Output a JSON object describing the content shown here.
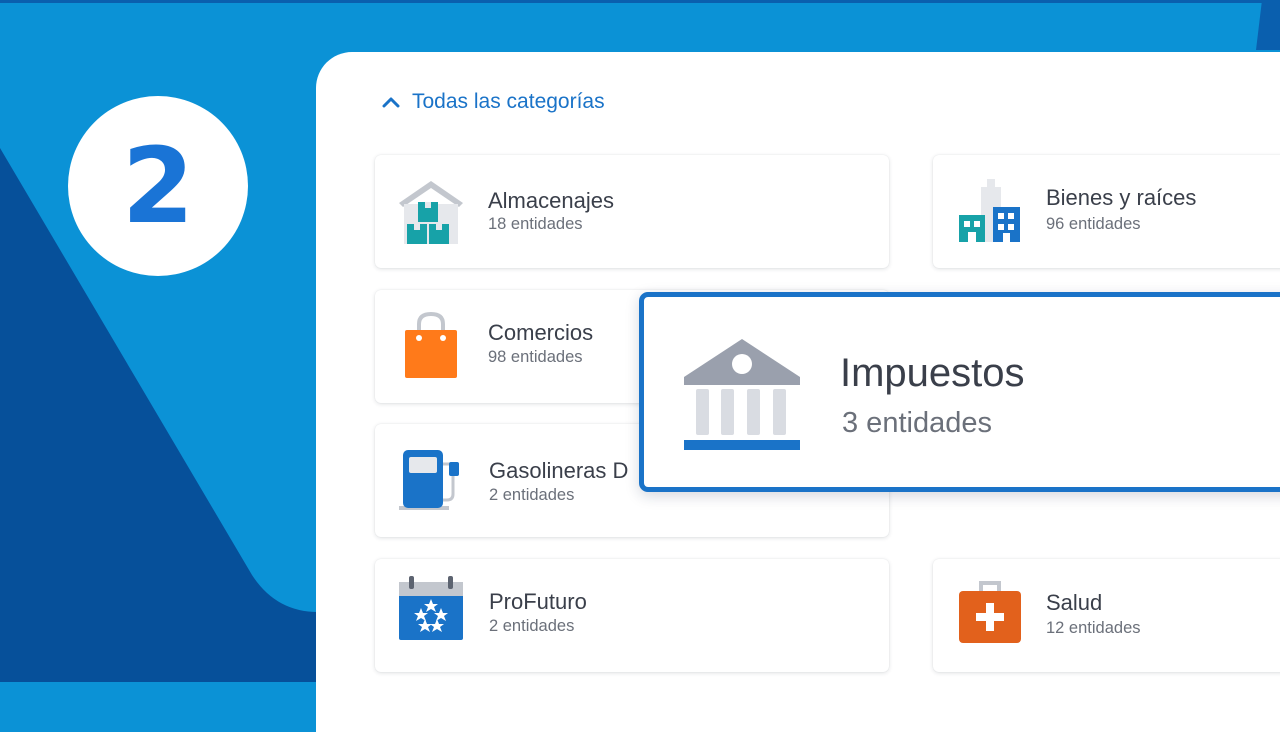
{
  "step": {
    "number": "2"
  },
  "header": {
    "all_categories_label": "Todas las categorías"
  },
  "categories": [
    {
      "title": "Almacenajes",
      "subtitle": "18 entidades",
      "icon": "warehouse-icon"
    },
    {
      "title": "Bienes y raíces",
      "subtitle": "96 entidades",
      "icon": "buildings-icon"
    },
    {
      "title": "Comercios",
      "subtitle": "98 entidades",
      "icon": "shopping-bag-icon"
    },
    {
      "title": "Gasolineras D",
      "subtitle": "2 entidades",
      "icon": "gas-pump-icon"
    },
    {
      "title": "ProFuturo",
      "subtitle": "2 entidades",
      "icon": "calendar-stars-icon"
    },
    {
      "title": "Salud",
      "subtitle": "12 entidades",
      "icon": "medical-kit-icon"
    }
  ],
  "highlight": {
    "title": "Impuestos",
    "subtitle": "3 entidades",
    "icon": "bank-icon"
  },
  "colors": {
    "background_light": "#0b92d6",
    "background_dark": "#06509a",
    "accent": "#1a73c8",
    "teal": "#17a2a8",
    "orange": "#ff7a1a",
    "red_orange": "#e2611c"
  }
}
